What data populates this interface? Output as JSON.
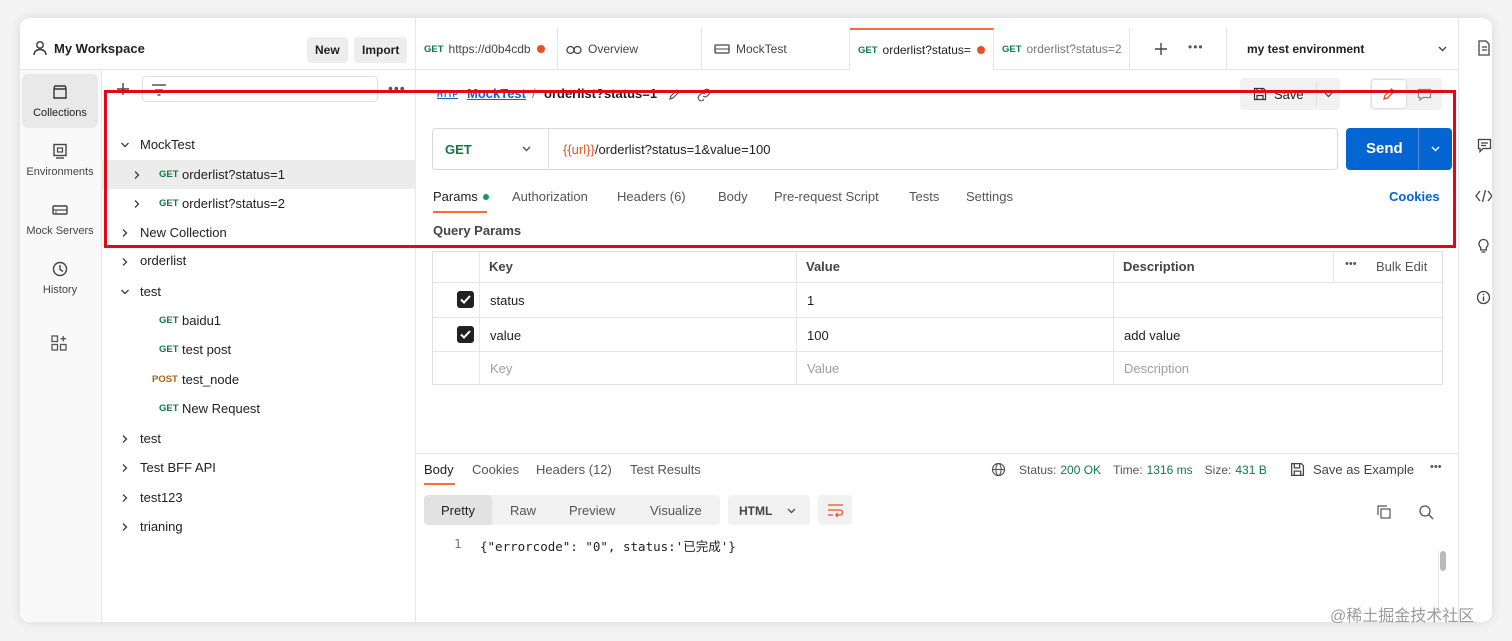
{
  "workspace": {
    "title": "My Workspace",
    "new_label": "New",
    "import_label": "Import"
  },
  "rail": [
    {
      "label": "Collections",
      "icon": "collections-icon"
    },
    {
      "label": "Environments",
      "icon": "environments-icon"
    },
    {
      "label": "Mock Servers",
      "icon": "mock-servers-icon"
    },
    {
      "label": "History",
      "icon": "history-icon"
    }
  ],
  "tabs": [
    {
      "method": "GET",
      "label": "https://d0b4cdb"
    },
    {
      "method": "",
      "label": "Overview"
    },
    {
      "method": "",
      "label": "MockTest"
    },
    {
      "method": "GET",
      "label": "orderlist?status="
    },
    {
      "method": "GET",
      "label": "orderlist?status=2"
    }
  ],
  "environment": "my test environment",
  "tree": [
    {
      "label": "MockTest"
    },
    {
      "method": "GET",
      "label": "orderlist?status=1"
    },
    {
      "method": "GET",
      "label": "orderlist?status=2"
    },
    {
      "label": "New Collection"
    },
    {
      "label": "orderlist"
    },
    {
      "label": "test"
    },
    {
      "method": "GET",
      "label": "baidu1"
    },
    {
      "method": "GET",
      "label": "test post"
    },
    {
      "method": "POST",
      "label": "test_node"
    },
    {
      "method": "GET",
      "label": "New Request"
    },
    {
      "label": "test"
    },
    {
      "label": "Test BFF API"
    },
    {
      "label": "test123"
    },
    {
      "label": "trianing"
    }
  ],
  "request": {
    "breadcrumb_collection": "MockTest",
    "breadcrumb_sep": "/",
    "name": "orderlist?status=1",
    "save_label": "Save",
    "method": "GET",
    "url_var": "{{url}}",
    "url_rest": "/orderlist?status=1&value=100",
    "send_label": "Send",
    "http_badge": "HTTP"
  },
  "request_tabs": [
    {
      "label": "Params"
    },
    {
      "label": "Authorization"
    },
    {
      "label": "Headers (6)"
    },
    {
      "label": "Body"
    },
    {
      "label": "Pre-request Script"
    },
    {
      "label": "Tests"
    },
    {
      "label": "Settings"
    }
  ],
  "cookies_label": "Cookies",
  "query_params_label": "Query Params",
  "params_table": {
    "headers": [
      "Key",
      "Value",
      "Description"
    ],
    "bulk_edit": "Bulk Edit",
    "rows": [
      {
        "key": "status",
        "value": "1",
        "description": ""
      },
      {
        "key": "value",
        "value": "100",
        "description": "add value"
      }
    ],
    "placeholder": {
      "key": "Key",
      "value": "Value",
      "description": "Description"
    }
  },
  "response": {
    "tabs": [
      "Body",
      "Cookies",
      "Headers (12)",
      "Test Results"
    ],
    "status_label": "Status:",
    "status_value": "200 OK",
    "time_label": "Time:",
    "time_value": "1316 ms",
    "size_label": "Size:",
    "size_value": "431 B",
    "save_example": "Save as Example",
    "view_tabs": [
      "Pretty",
      "Raw",
      "Preview",
      "Visualize"
    ],
    "format": "HTML",
    "line_no": "1",
    "line_text": "{\"errorcode\": \"0\", status:'已完成'}"
  },
  "watermark": "@稀土掘金技术社区",
  "colors": {
    "accent": "#ff6c37",
    "send": "#0265d2",
    "get": "#0f7b43",
    "post": "#a8641b",
    "highlight": "#e00914",
    "status_ok": "#0f7b43"
  }
}
